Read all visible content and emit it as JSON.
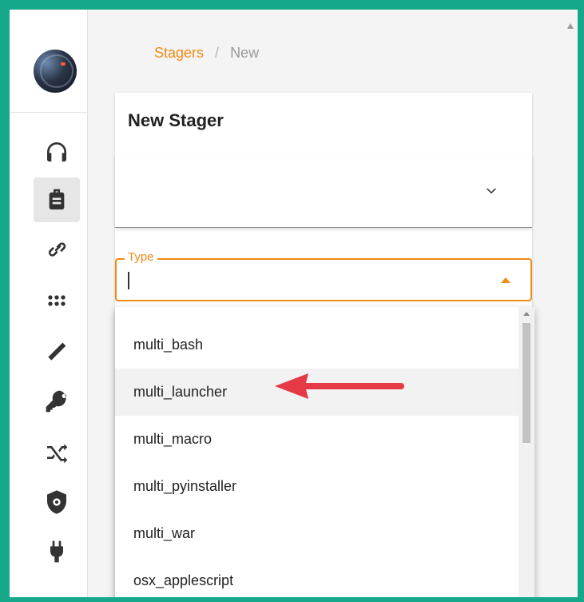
{
  "breadcrumb": {
    "parent": "Stagers",
    "separator": "/",
    "current": "New"
  },
  "page": {
    "title": "New Stager"
  },
  "form": {
    "first_select": {
      "value": ""
    },
    "type_field": {
      "label": "Type",
      "value": ""
    }
  },
  "sidebar": {
    "items": [
      {
        "icon": "headphones-icon",
        "name": "listeners"
      },
      {
        "icon": "briefcase-icon",
        "name": "stagers",
        "active": true
      },
      {
        "icon": "link-icon",
        "name": "agents"
      },
      {
        "icon": "grid-dots-icon",
        "name": "modules"
      },
      {
        "icon": "wand-icon",
        "name": "plugins"
      },
      {
        "icon": "key-icon",
        "name": "credentials"
      },
      {
        "icon": "shuffle-icon",
        "name": "obfuscation"
      },
      {
        "icon": "shield-gear-icon",
        "name": "settings"
      },
      {
        "icon": "plug-icon",
        "name": "connection"
      }
    ]
  },
  "dropdown": {
    "options": [
      "multi_bash",
      "multi_launcher",
      "multi_macro",
      "multi_pyinstaller",
      "multi_war",
      "osx_applescript"
    ],
    "highlighted": "multi_launcher"
  },
  "colors": {
    "accent": "#f08a14",
    "frame": "#16a88a",
    "annotation_arrow": "#e63946"
  }
}
